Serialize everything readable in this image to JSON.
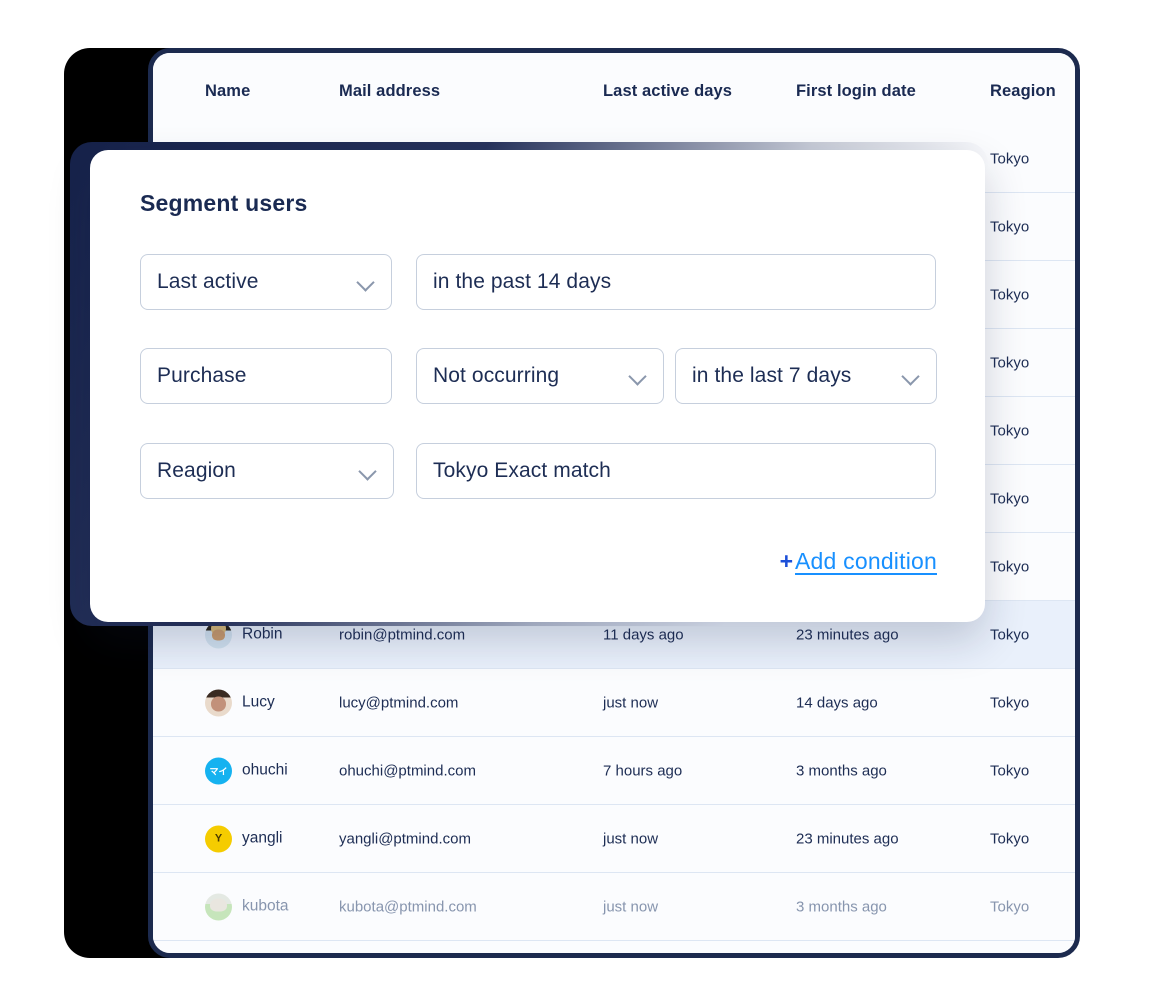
{
  "table": {
    "columns": [
      "Name",
      "Mail address",
      "Last active days",
      "First login date",
      "Reagion"
    ],
    "hidden_rows_region": [
      "Tokyo",
      "Tokyo",
      "Tokyo",
      "Tokyo",
      "Tokyo",
      "Tokyo",
      "Tokyo"
    ],
    "rows": [
      {
        "name": "Robin",
        "mail": "robin@ptmind.com",
        "last_active": "11 days  ago",
        "first_login": "23 minutes ago",
        "region": "Tokyo",
        "avatar": "photo-avatar",
        "avatar_initial": "",
        "highlight": true,
        "faded": false
      },
      {
        "name": "Lucy",
        "mail": "lucy@ptmind.com",
        "last_active": "just now",
        "first_login": "14 days  ago",
        "region": "Tokyo",
        "avatar": "photo-avatar",
        "avatar_initial": "",
        "highlight": false,
        "faded": false
      },
      {
        "name": "ohuchi",
        "mail": "ohuchi@ptmind.com",
        "last_active": "7 hours ago",
        "first_login": "3 months ago",
        "region": "Tokyo",
        "avatar": "initial-avatar",
        "avatar_initial": "マイ",
        "avatar_color": "#15b2f0",
        "highlight": false,
        "faded": false
      },
      {
        "name": "yangli",
        "mail": "yangli@ptmind.com",
        "last_active": "just now",
        "first_login": "23 minutes ago",
        "region": "Tokyo",
        "avatar": "initial-avatar",
        "avatar_initial": "Y",
        "avatar_color": "#f5cc00",
        "highlight": false,
        "faded": false
      },
      {
        "name": "kubota",
        "mail": "kubota@ptmind.com",
        "last_active": "just now",
        "first_login": "3 months ago",
        "region": "Tokyo",
        "avatar": "photo-avatar",
        "avatar_initial": "",
        "highlight": false,
        "faded": true
      }
    ]
  },
  "modal": {
    "title": "Segment users",
    "conditions": [
      {
        "attribute": "Last active",
        "attribute_has_chevron": true,
        "value": "in the past 14 days",
        "value_has_chevron": false
      },
      {
        "attribute": "Purchase",
        "attribute_has_chevron": false,
        "operator": "Not occurring",
        "operator_has_chevron": true,
        "value": "in the last 7 days",
        "value_has_chevron": true
      },
      {
        "attribute": "Reagion",
        "attribute_has_chevron": true,
        "value": "Tokyo Exact match",
        "value_has_chevron": false
      }
    ],
    "add_condition": {
      "plus": "+",
      "label": "Add condition"
    }
  },
  "colors": {
    "navy": "#1a2a52",
    "link_blue": "#1890ff",
    "plus_blue": "#1c4fd8",
    "row_highlight": "#e9f0fb",
    "card_border": "#1c2a4e"
  }
}
